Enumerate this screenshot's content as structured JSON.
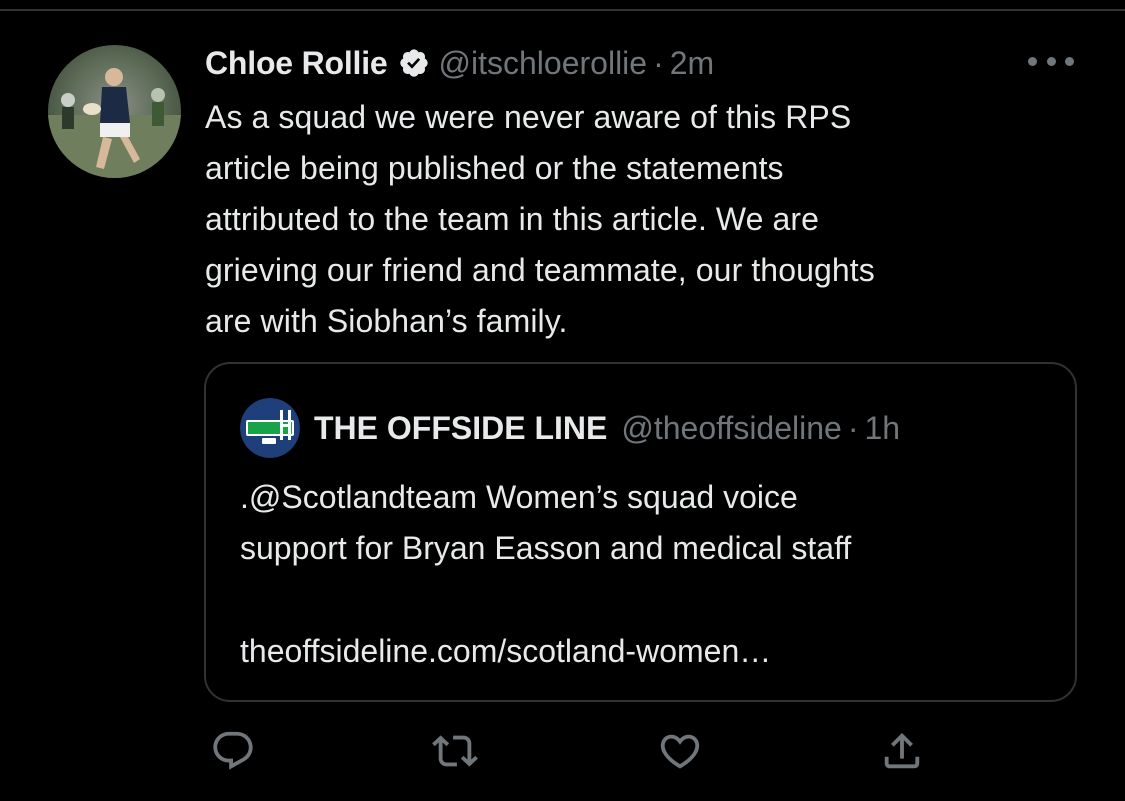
{
  "tweet": {
    "author": {
      "display_name": "Chloe Rollie",
      "handle": "@itschloerollie",
      "verified": true,
      "avatar_icon": "rugby-player-avatar"
    },
    "separator": "·",
    "time": "2m",
    "text": "As a squad we were never aware of this RPS\narticle being published or the statements\nattributed to the team in this article. We are\ngrieving our friend and teammate, our thoughts\nare with Siobhan’s family.",
    "more_icon": "more-options-icon"
  },
  "quoted_tweet": {
    "logo_icon": "the-offside-line-logo",
    "display_name": "THE OFFSIDE LINE",
    "handle": "@theoffsideline",
    "separator": "·",
    "time": "1h",
    "text": ".@Scotlandteam Women’s squad voice\nsupport for Bryan Easson and medical staff",
    "link": "theoffsideline.com/scotland-women…"
  },
  "actions": [
    {
      "name": "reply",
      "icon": "reply-icon"
    },
    {
      "name": "retweet",
      "icon": "retweet-icon"
    },
    {
      "name": "like",
      "icon": "heart-icon"
    },
    {
      "name": "share",
      "icon": "share-icon"
    }
  ],
  "colors": {
    "background": "#000000",
    "text_primary": "#e7e9ea",
    "text_secondary": "#71767b",
    "border": "#2f3336"
  }
}
